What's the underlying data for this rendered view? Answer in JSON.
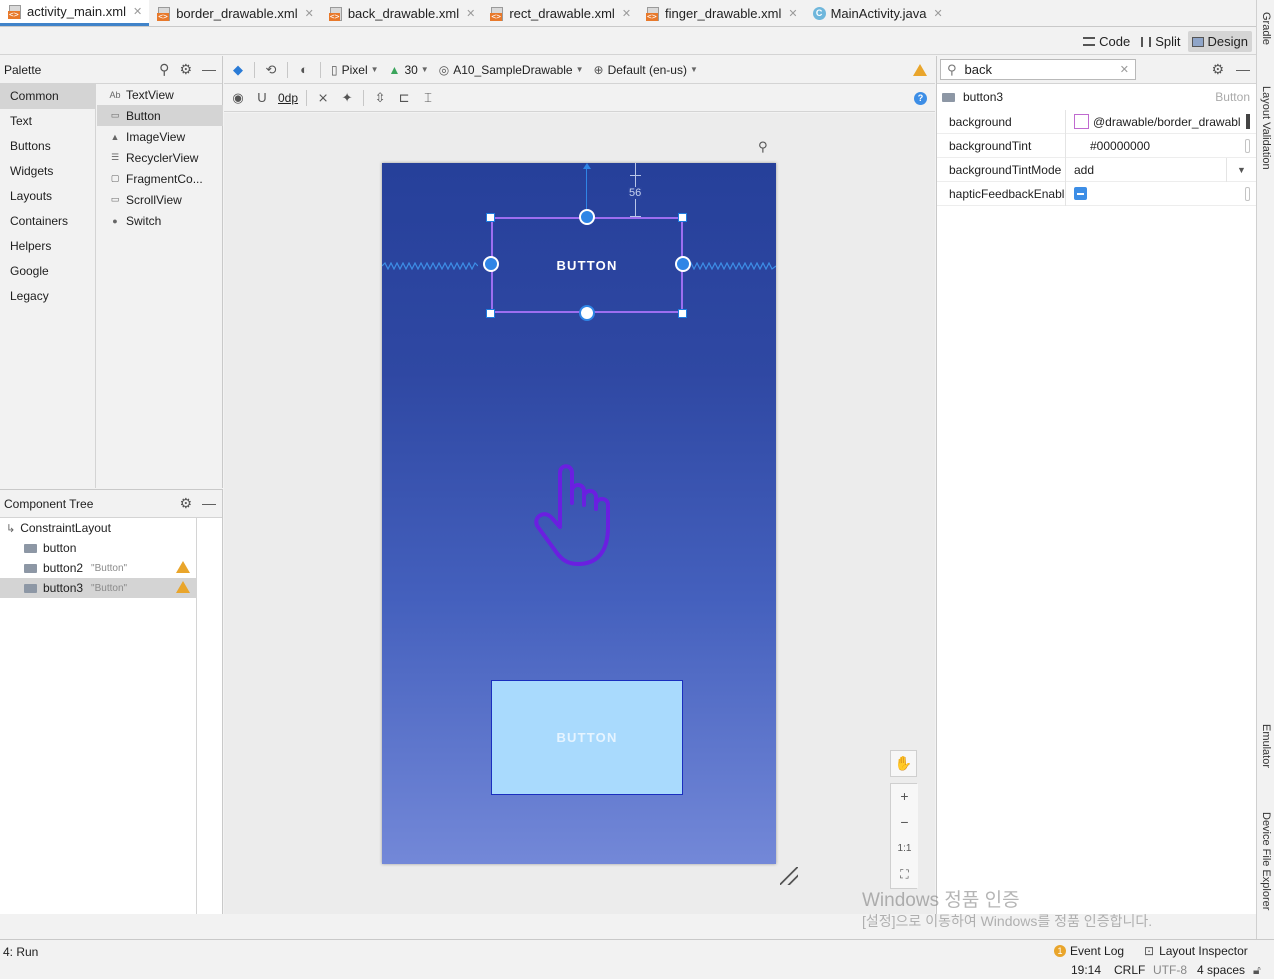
{
  "tabs": [
    {
      "label": "activity_main.xml",
      "type": "xml",
      "active": true
    },
    {
      "label": "border_drawable.xml",
      "type": "xml"
    },
    {
      "label": "back_drawable.xml",
      "type": "xml"
    },
    {
      "label": "rect_drawable.xml",
      "type": "xml"
    },
    {
      "label": "finger_drawable.xml",
      "type": "xml"
    },
    {
      "label": "MainActivity.java",
      "type": "java"
    }
  ],
  "view_modes": {
    "code": "Code",
    "split": "Split",
    "design": "Design"
  },
  "palette": {
    "title": "Palette",
    "categories": [
      "Common",
      "Text",
      "Buttons",
      "Widgets",
      "Layouts",
      "Containers",
      "Helpers",
      "Google",
      "Legacy"
    ],
    "items": [
      {
        "icon": "Ab",
        "label": "TextView"
      },
      {
        "icon": "▭",
        "label": "Button"
      },
      {
        "icon": "▲",
        "label": "ImageView"
      },
      {
        "icon": "☰",
        "label": "RecyclerView"
      },
      {
        "icon": "▢",
        "label": "FragmentCo..."
      },
      {
        "icon": "▭",
        "label": "ScrollView"
      },
      {
        "icon": "●",
        "label": "Switch"
      }
    ]
  },
  "component_tree": {
    "title": "Component Tree",
    "root": "ConstraintLayout",
    "children": [
      {
        "id": "button",
        "text": ""
      },
      {
        "id": "button2",
        "text": "\"Button\""
      },
      {
        "id": "button3",
        "text": "\"Button\""
      }
    ]
  },
  "design_toolbar": {
    "device": "Pixel",
    "api": "30",
    "theme": "A10_SampleDrawable",
    "locale": "Default (en-us)",
    "default_margin": "0dp"
  },
  "canvas": {
    "button_top_label": "BUTTON",
    "button_bottom_label": "BUTTON",
    "margin_value": "56"
  },
  "attributes": {
    "search": "back",
    "component_id": "button3",
    "component_type": "Button",
    "rows": [
      {
        "name": "background",
        "value": "@drawable/border_drawabl"
      },
      {
        "name": "backgroundTint",
        "value": "#00000000"
      },
      {
        "name": "backgroundTintMode",
        "value": "add"
      },
      {
        "name": "hapticFeedbackEnabl...",
        "value": ""
      }
    ]
  },
  "side_tools": [
    "Gradle",
    "Layout Validation",
    "Emulator",
    "Device File Explorer"
  ],
  "bottom": {
    "run": "4: Run",
    "event_log": "Event Log",
    "layout_inspector": "Layout Inspector"
  },
  "status": {
    "time": "19:14",
    "line_sep": "CRLF",
    "encoding": "UTF-8",
    "indent": "4 spaces"
  },
  "watermark": {
    "line1": "Windows 정품 인증",
    "line2": "[설정]으로 이동하여 Windows를 정품 인증합니다."
  },
  "colors": {
    "accent": "#4083c9",
    "selection": "#9d6ef0",
    "handle": "#2f85e6",
    "finger": "#6a1fe0"
  }
}
